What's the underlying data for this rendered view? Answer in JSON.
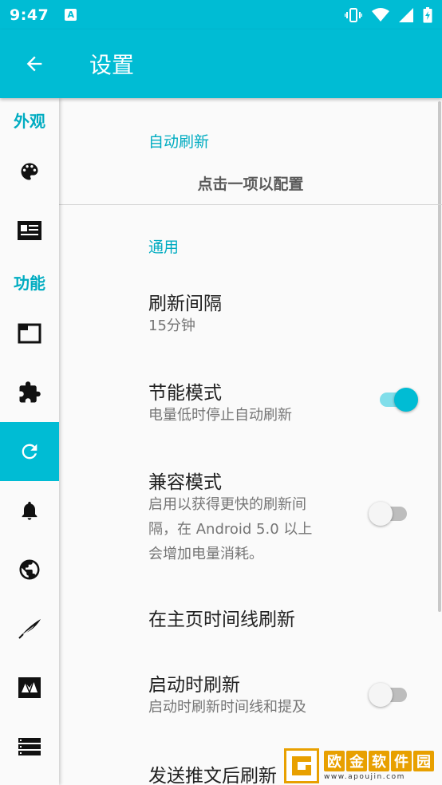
{
  "status_bar": {
    "time": "9:47",
    "notification_icon": "A"
  },
  "toolbar": {
    "title": "设置",
    "back_icon": "arrow-back-icon"
  },
  "sidebar": {
    "headers": [
      "外观",
      "功能"
    ],
    "items": [
      {
        "icon": "palette-icon"
      },
      {
        "icon": "article-icon"
      },
      {
        "icon": "tab-icon"
      },
      {
        "icon": "extension-icon"
      },
      {
        "icon": "refresh-icon",
        "active": true
      },
      {
        "icon": "bell-icon"
      },
      {
        "icon": "globe-icon"
      },
      {
        "icon": "quill-icon"
      },
      {
        "icon": "mail-icon"
      },
      {
        "icon": "list-icon"
      }
    ]
  },
  "content": {
    "auto_refresh_label": "自动刷新",
    "hint": "点击一项以配置",
    "general_label": "通用",
    "prefs": [
      {
        "title": "刷新间隔",
        "summary": "15分钟"
      },
      {
        "title": "节能模式",
        "summary": "电量低时停止自动刷新",
        "switch": "on"
      },
      {
        "title": "兼容模式",
        "summary_lines": [
          "启用以获得更快的刷新间",
          "隔，在 Android 5.0 以上",
          "会增加电量消耗。"
        ],
        "switch": "off"
      },
      {
        "title": "在主页时间线刷新"
      },
      {
        "title": "启动时刷新",
        "summary": "启动时刷新时间线和提及",
        "switch": "off"
      },
      {
        "title": "发送推文后刷新"
      }
    ]
  },
  "watermark": {
    "chars": [
      "欧",
      "金",
      "软",
      "件",
      "园"
    ],
    "url": "www.apoujin.com"
  },
  "colors": {
    "primary": "#00bcd4",
    "accent_text": "#00acc1"
  }
}
